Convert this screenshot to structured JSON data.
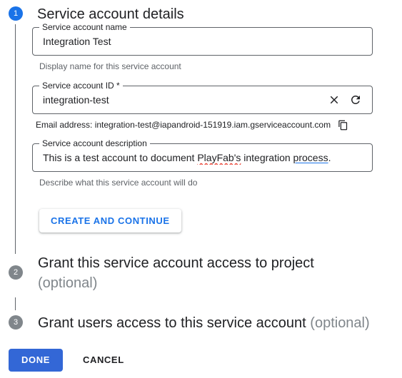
{
  "steps": [
    {
      "number": "1",
      "state": "active",
      "title": "Service account details",
      "optional": ""
    },
    {
      "number": "2",
      "state": "inactive",
      "title": "Grant this service account access to project",
      "optional": "(optional)"
    },
    {
      "number": "3",
      "state": "inactive",
      "title": "Grant users access to this service account",
      "optional": "(optional)"
    }
  ],
  "fields": {
    "name": {
      "label": "Service account name",
      "value": "Integration Test",
      "placeholder": "Service account name",
      "hint": "Display name for this service account"
    },
    "id": {
      "label": "Service account ID *",
      "value": "integration-test",
      "placeholder": "Service account ID",
      "clear_icon": "close-icon",
      "refresh_icon": "refresh-icon",
      "email_prefix": "Email address: ",
      "email_value": "integration-test@iapandroid-151919.iam.gserviceaccount.com",
      "copy_icon": "copy-icon"
    },
    "description": {
      "label": "Service account description",
      "value_part1": "This is a test account to document ",
      "value_misspelled": "PlayFab's",
      "value_part2": " integration ",
      "value_linked": "process",
      "value_part3": ".",
      "placeholder": "Service account description",
      "hint": "Describe what this service account will do"
    }
  },
  "buttons": {
    "create_and_continue": "CREATE AND CONTINUE",
    "done": "DONE",
    "cancel": "CANCEL"
  },
  "colors": {
    "accent": "#1a73e8",
    "primary_button": "#3367d6",
    "inactive_badge": "#80868b",
    "spellcheck": "#ea4335",
    "text": "#202124",
    "muted_text": "#5f6368"
  }
}
